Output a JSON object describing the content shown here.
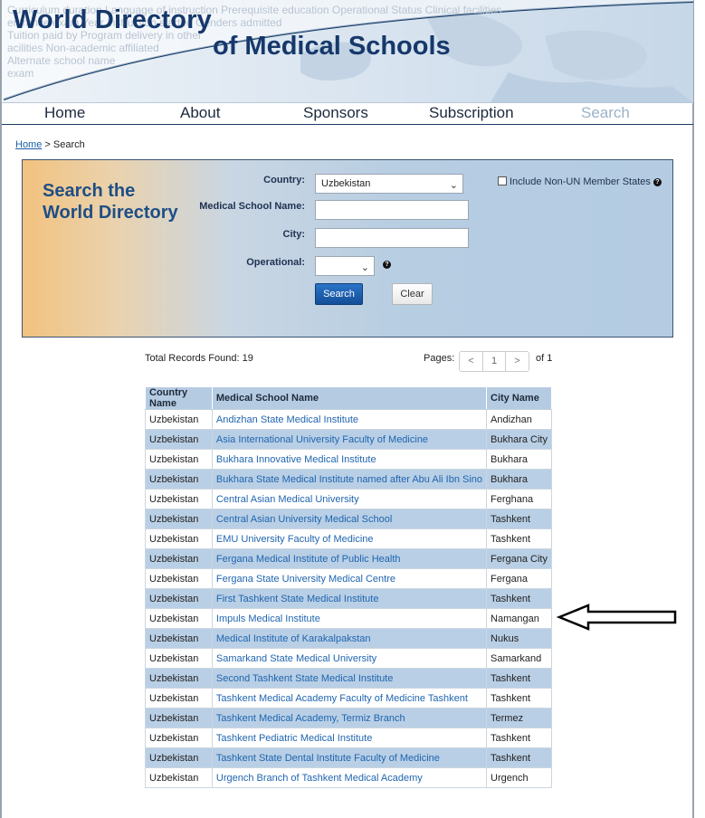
{
  "header": {
    "title_line1": "World Directory",
    "title_line2": "of Medical Schools",
    "background_text": [
      "Curriculum duration  Language of instruction  Prerequisite education  Operational Status  Clinical facilities",
      "entrance exam  Year instruction started  Genders admitted",
      "Tuition paid by  Program delivery in other",
      "acilities  Non-academic affiliated",
      "Alternate school name",
      "exam"
    ]
  },
  "nav": {
    "items": [
      {
        "label": "Home"
      },
      {
        "label": "About"
      },
      {
        "label": "Sponsors"
      },
      {
        "label": "Subscription"
      },
      {
        "label": "Search"
      }
    ]
  },
  "breadcrumb": {
    "home": "Home",
    "separator": ">",
    "current": "Search"
  },
  "search_panel": {
    "title_line1": "Search the",
    "title_line2": "World Directory",
    "country_label": "Country:",
    "country_value": "Uzbekistan",
    "school_label": "Medical School Name:",
    "school_value": "",
    "city_label": "City:",
    "city_value": "",
    "operational_label": "Operational:",
    "operational_value": "",
    "include_label": "Include Non-UN Member States",
    "include_checked": false,
    "search_button": "Search",
    "clear_button": "Clear"
  },
  "results": {
    "total_label": "Total Records Found: 19",
    "pages_label": "Pages:",
    "prev": "<",
    "current_page": "1",
    "next": ">",
    "of_label": "of 1",
    "columns": [
      "Country Name",
      "Medical School Name",
      "City Name"
    ],
    "rows": [
      [
        "Uzbekistan",
        "Andizhan State Medical Institute",
        "Andizhan"
      ],
      [
        "Uzbekistan",
        "Asia International University Faculty of Medicine",
        "Bukhara City"
      ],
      [
        "Uzbekistan",
        "Bukhara Innovative Medical Institute",
        "Bukhara"
      ],
      [
        "Uzbekistan",
        "Bukhara State Medical Institute named after Abu Ali Ibn Sino",
        "Bukhara"
      ],
      [
        "Uzbekistan",
        "Central Asian Medical University",
        "Ferghana"
      ],
      [
        "Uzbekistan",
        "Central Asian University Medical School",
        "Tashkent"
      ],
      [
        "Uzbekistan",
        "EMU University Faculty of Medicine",
        "Tashkent"
      ],
      [
        "Uzbekistan",
        "Fergana Medical Institute of Public Health",
        "Fergana City"
      ],
      [
        "Uzbekistan",
        "Fergana State University Medical Centre",
        "Fergana"
      ],
      [
        "Uzbekistan",
        "First Tashkent State Medical Institute",
        "Tashkent"
      ],
      [
        "Uzbekistan",
        "Impuls Medical Institute",
        "Namangan"
      ],
      [
        "Uzbekistan",
        "Medical Institute of Karakalpakstan",
        "Nukus"
      ],
      [
        "Uzbekistan",
        "Samarkand State Medical University",
        "Samarkand"
      ],
      [
        "Uzbekistan",
        "Second Tashkent State Medical Institute",
        "Tashkent"
      ],
      [
        "Uzbekistan",
        "Tashkent Medical Academy Faculty of Medicine Tashkent",
        "Tashkent"
      ],
      [
        "Uzbekistan",
        "Tashkent Medical Academy, Termiz Branch",
        "Termez"
      ],
      [
        "Uzbekistan",
        "Tashkent Pediatric Medical Institute",
        "Tashkent"
      ],
      [
        "Uzbekistan",
        "Tashkent State Dental Institute Faculty of Medicine",
        "Tashkent"
      ],
      [
        "Uzbekistan",
        "Urgench Branch of Tashkent Medical Academy",
        "Urgench"
      ]
    ]
  },
  "annotation": {
    "icon": "left-arrow-icon"
  },
  "colors": {
    "brand_blue": "#16386b",
    "link": "#1f65b0",
    "row_alt": "#b9cfe5",
    "header_row": "#b5cbe2"
  }
}
